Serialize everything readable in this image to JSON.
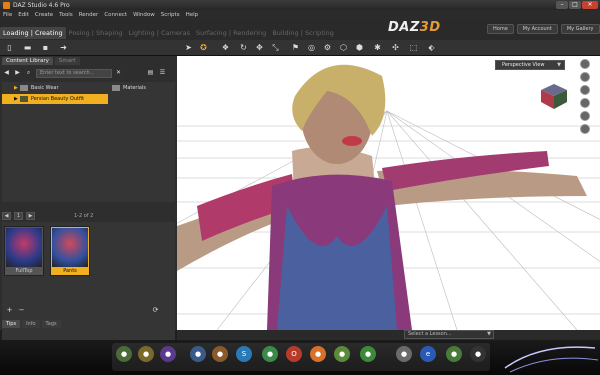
{
  "window": {
    "title": "DAZ Studio 4.6 Pro",
    "minimize": "–",
    "maximize": "□",
    "close": "✕"
  },
  "menu": [
    "File",
    "Edit",
    "Create",
    "Tools",
    "Render",
    "Connect",
    "Window",
    "Scripts",
    "Help"
  ],
  "logo": {
    "part1": "DAZ",
    "part2": "3D"
  },
  "top_buttons": [
    "Home",
    "My Account",
    "My Gallery"
  ],
  "room_tabs": [
    {
      "label": "Loading | Creating",
      "active": true
    },
    {
      "label": "Posing | Shaping",
      "active": false
    },
    {
      "label": "Lighting | Cameras",
      "active": false
    },
    {
      "label": "Surfacing | Rendering",
      "active": false
    },
    {
      "label": "Building | Scripting",
      "active": false
    }
  ],
  "left_panel": {
    "tabs": [
      {
        "label": "Content Library",
        "active": true
      },
      {
        "label": "Smart",
        "active": false
      }
    ],
    "search_placeholder": "Enter text to search...",
    "tree": [
      {
        "label": "Basic Wear",
        "selected": false
      },
      {
        "label": "Persian Beauty Outfit",
        "selected": true
      }
    ],
    "right_folder": "Materials",
    "pager": {
      "page": "1",
      "label": "1-2 of 2"
    },
    "thumbs": [
      {
        "label": "FullTop",
        "selected": false
      },
      {
        "label": "Pants",
        "selected": true
      }
    ],
    "bottom_tabs": [
      {
        "label": "Tips",
        "active": true
      },
      {
        "label": "Info",
        "active": false
      },
      {
        "label": "Tags",
        "active": false
      }
    ]
  },
  "viewport": {
    "camera": "Perspective View"
  },
  "lesson_select": "Select a Lesson...",
  "colors": {
    "accent": "#f0b020",
    "panel": "#2e2e2e",
    "viewport_bg": "#ffffff"
  },
  "dock_icons": [
    "globe-icon",
    "chrome-icon",
    "steam-icon",
    "photoshop-icon",
    "media-icon",
    "skype-icon",
    "music-icon",
    "opera-icon",
    "firefox-icon",
    "chrome2-icon",
    "vlc-icon",
    "trash-icon",
    "ie-icon",
    "game-icon",
    "app-icon"
  ]
}
